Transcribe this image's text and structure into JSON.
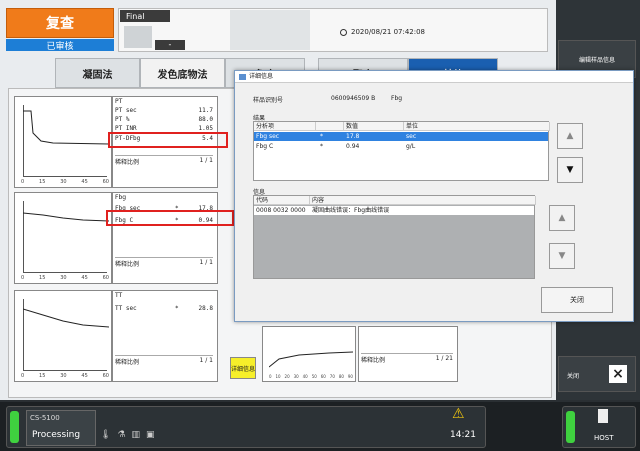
{
  "header": {
    "review_label": "复查",
    "audited_label": "已审核",
    "final_label": "Final",
    "dash": "-",
    "datetime": "2020/08/21 07:42:08"
  },
  "tabs": [
    {
      "label": "凝固法"
    },
    {
      "label": "发色底物法"
    },
    {
      "label": "免疫"
    },
    {
      "label": "聚合"
    },
    {
      "label": "其他"
    }
  ],
  "panels": {
    "pt": {
      "title": "PT",
      "rows": [
        {
          "name": "PT sec",
          "mark": "",
          "value": "11.7"
        },
        {
          "name": "PT %",
          "mark": "",
          "value": "88.0"
        },
        {
          "name": "PT INR",
          "mark": "",
          "value": "1.05"
        },
        {
          "name": "PT-DFbg",
          "mark": "",
          "value": "5.4"
        }
      ],
      "dilution_label": "稀释比例",
      "dilution_value": "1 / 1",
      "ticks": [
        "0",
        "15",
        "30",
        "45",
        "60"
      ]
    },
    "fbg": {
      "title": "Fbg",
      "rows": [
        {
          "name": "Fbg sec",
          "mark": "*",
          "value": "17.8"
        },
        {
          "name": "Fbg C",
          "mark": "*",
          "value": "0.94"
        }
      ],
      "dilution_label": "稀释比例",
      "dilution_value": "1 / 1",
      "ticks": [
        "0",
        "15",
        "30",
        "45",
        "60"
      ]
    },
    "tt": {
      "title": "TT",
      "rows": [
        {
          "name": "TT sec",
          "mark": "*",
          "value": "28.8"
        }
      ],
      "dilution_label": "稀释比例",
      "dilution_value": "1 / 1",
      "ticks": [
        "0",
        "15",
        "30",
        "45",
        "60"
      ]
    },
    "right_bottom": {
      "dilution_label": "稀释比例",
      "dilution_value": "1 / 21",
      "ticks": [
        "0",
        "10",
        "20",
        "30",
        "40",
        "50",
        "60",
        "70",
        "80",
        "90"
      ]
    }
  },
  "detail_button": "详细信息",
  "side": {
    "edit_sample": "编辑样品信息",
    "close_label": "关闭",
    "close_icon": "×"
  },
  "status": {
    "model": "CS-5100",
    "processing": "Processing",
    "time": "14:21",
    "host": "HOST",
    "warning_icon": "⚠"
  },
  "dialog": {
    "title": "详细信息",
    "sample_label": "样品识别号",
    "sample_id": "0600946509 B",
    "sample_item": "Fbg",
    "results_label": "结果",
    "results_headers": [
      "分析项",
      "",
      "数值",
      "单位"
    ],
    "results_rows": [
      {
        "item": "Fbg sec",
        "mark": "*",
        "value": "17.8",
        "unit": "sec"
      },
      {
        "item": "Fbg C",
        "mark": "*",
        "value": "0.94",
        "unit": "g/L"
      }
    ],
    "info_label": "信息",
    "info_headers": [
      "代码",
      "内容"
    ],
    "info_rows": [
      {
        "code": "0008 0032 0000",
        "content": "凝固曲线错误：Fbg曲线错误"
      }
    ],
    "close_button": "关闭",
    "up_arrow": "▲",
    "down_arrow": "▼"
  }
}
